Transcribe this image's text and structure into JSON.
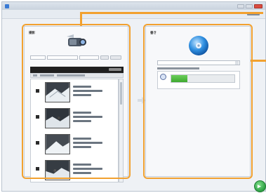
{
  "window": {
    "title": "",
    "accent_color": "#f2a12f"
  },
  "source_panel": {
    "title": "撮影",
    "icon": "camcorder-icon",
    "clips": [
      {
        "thumbnail": "ski-video-thumbnail"
      },
      {
        "thumbnail": "ski-video-thumbnail"
      },
      {
        "thumbnail": "ski-video-thumbnail"
      },
      {
        "thumbnail": "ski-video-thumbnail"
      }
    ]
  },
  "destination_panel": {
    "title": "書き",
    "icon": "disc-icon",
    "space_used_fraction": 0.25,
    "fill_color": "#4cb83b"
  },
  "actions": {
    "go_icon": "play-arrow-icon",
    "go_glyph": "▸"
  }
}
